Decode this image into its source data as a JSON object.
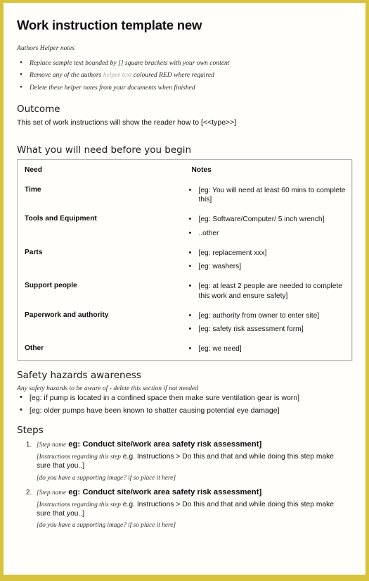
{
  "document": {
    "title": "Work instruction template new",
    "frame_color": "#d9c33c",
    "page_background": "#fffefb"
  },
  "author_notes": {
    "heading": "Authors Helper notes",
    "items": [
      {
        "pre": "Replace sample text bounded by [] square brackets with your own content",
        "faded": "",
        "post": ""
      },
      {
        "pre": "Remove any of the authors ",
        "faded": "helper text",
        "post": " coloured RED where required"
      },
      {
        "pre": "Delete these helper notes from your documents when finished",
        "faded": "",
        "post": ""
      }
    ]
  },
  "outcome": {
    "heading": "Outcome",
    "text": "This set of work instructions will show the reader how to [<<type>>]"
  },
  "needs": {
    "heading": "What you will need before you begin",
    "columns": [
      "Need",
      "Notes"
    ],
    "rows": [
      {
        "need": "Time",
        "notes": [
          "[eg: You will need at least 60 mins to complete this]"
        ]
      },
      {
        "need": "Tools and Equipment",
        "notes": [
          "[eg: Software/Computer/ 5 inch wrench]",
          "..other"
        ]
      },
      {
        "need": "Parts",
        "notes": [
          "[eg: replacement xxx]",
          "[eg: washers]"
        ]
      },
      {
        "need": "Support people",
        "notes": [
          "[eg: at least 2 people are needed to complete this work and ensure safety]"
        ]
      },
      {
        "need": "Paperwork and authority",
        "notes": [
          "[eg: authority from owner to enter site]",
          "[eg: safety risk assessment form]"
        ]
      },
      {
        "need": "Other",
        "notes": [
          "[eg: we need]"
        ]
      }
    ]
  },
  "safety": {
    "heading": "Safety hazards awareness",
    "helper": "Any safety hazards to be aware of - delete this section if not needed",
    "items": [
      "[eg: if pump is located in a confined space then make sure ventilation gear is worn]",
      "[eg: older pumps have been known to shatter causing potential eye damage]"
    ]
  },
  "steps": {
    "heading": "Steps",
    "items": [
      {
        "title_italic": "[Step name",
        "title_bold": " eg: Conduct site/work area safety risk assessment]",
        "instructions_italic": "[Instructions regarding this step",
        "instructions_text": " e.g. Instructions > Do this and that and while doing this step make sure that you..]",
        "image_note_italic": "[do you have a supporting image? if so place it here",
        "image_note_tail": "]"
      },
      {
        "title_italic": "[Step name",
        "title_bold": " eg: Conduct site/work area safety risk assessment]",
        "instructions_italic": "[Instructions regarding this step",
        "instructions_text": " e.g. Instructions > Do this and that and while doing this step make sure that you..]",
        "image_note_italic": "[do you have a supporting image? if so place it here",
        "image_note_tail": "]"
      }
    ]
  }
}
